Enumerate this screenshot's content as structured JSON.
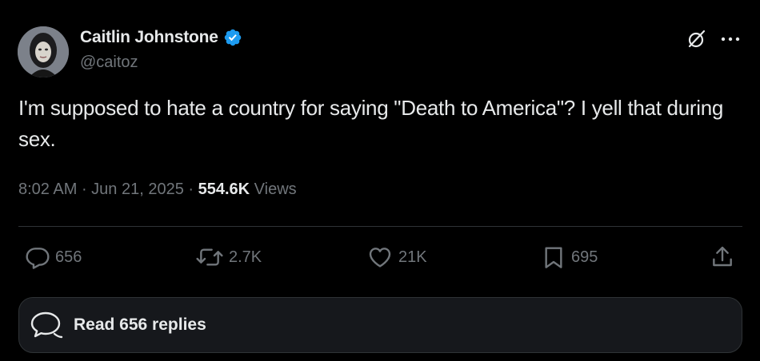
{
  "author": {
    "display_name": "Caitlin Johnstone",
    "handle": "@caitoz",
    "verified": true
  },
  "tweet": {
    "text": "I'm supposed to hate a country for saying \"Death to America\"? I yell that during sex.",
    "time": "8:02 AM",
    "date": "Jun 21, 2025",
    "views_count": "554.6K",
    "views_label": "Views"
  },
  "actions": {
    "replies": "656",
    "reposts": "2.7K",
    "likes": "21K",
    "bookmarks": "695"
  },
  "read_replies": {
    "label": "Read 656 replies"
  },
  "colors": {
    "background": "#000000",
    "text_primary": "#e7e9ea",
    "text_secondary": "#71767b",
    "verified_blue": "#1d9bf0",
    "divider": "#2f3336"
  },
  "icons": [
    "verified-badge-icon",
    "grok-icon",
    "more-icon",
    "reply-icon",
    "repost-icon",
    "like-icon",
    "bookmark-icon",
    "share-icon",
    "replies-bubble-icon"
  ]
}
